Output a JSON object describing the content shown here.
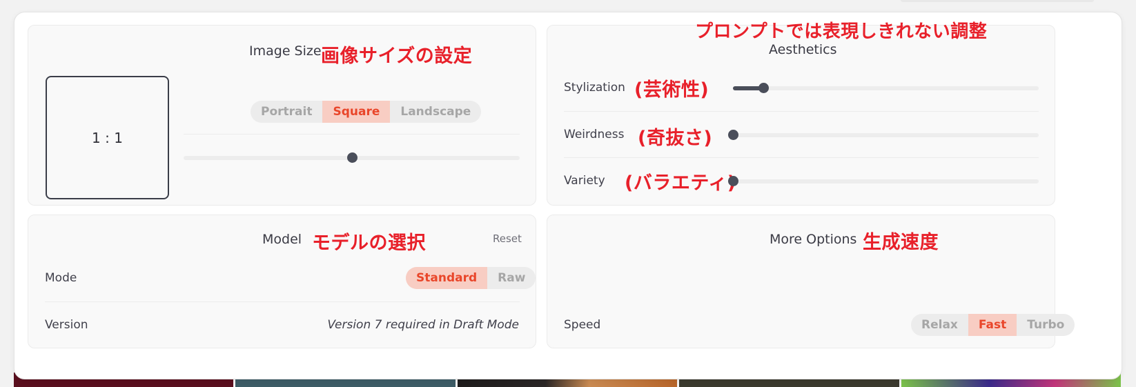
{
  "image_size": {
    "title": "Image Size",
    "annotation": "画像サイズの設定",
    "ratio": "1 : 1",
    "orientation_options": [
      {
        "label": "Portrait",
        "active": false
      },
      {
        "label": "Square",
        "active": true
      },
      {
        "label": "Landscape",
        "active": false
      }
    ],
    "ratio_slider_value": 0.5
  },
  "aesthetics": {
    "title": "Aesthetics",
    "annotation": "プロンプトでは表現しきれない調整",
    "sliders": [
      {
        "label": "Stylization",
        "annotation": "(芸術性)",
        "value": 0.1
      },
      {
        "label": "Weirdness",
        "annotation": "(奇抜さ)",
        "value": 0.0
      },
      {
        "label": "Variety",
        "annotation": "(バラエティ)",
        "value": 0.0
      }
    ]
  },
  "model": {
    "title": "Model",
    "annotation": "モデルの選択",
    "reset_label": "Reset",
    "mode_label": "Mode",
    "mode_options": [
      {
        "label": "Standard",
        "active": true
      },
      {
        "label": "Raw",
        "active": false
      }
    ],
    "version_label": "Version",
    "version_note": "Version 7 required in Draft Mode"
  },
  "more_options": {
    "title": "More Options",
    "annotation": "生成速度",
    "speed_label": "Speed",
    "speed_options": [
      {
        "label": "Relax",
        "active": false
      },
      {
        "label": "Fast",
        "active": true
      },
      {
        "label": "Turbo",
        "active": false
      }
    ]
  },
  "colors": {
    "accent": "#e9462a",
    "accent_bg": "#f8cdc3",
    "annotation_red": "#e8202a",
    "slider_dark": "#4a4e5a"
  },
  "gallery_colors": [
    "#5a0f1e",
    "#3d5c66",
    "#2a2626",
    "#3b3a2e",
    "#7bc24a"
  ]
}
